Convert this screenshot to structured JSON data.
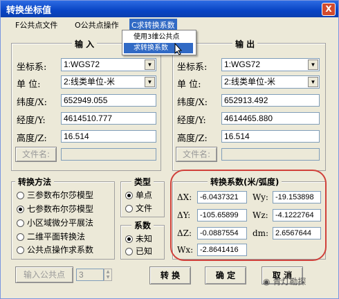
{
  "window": {
    "title": "转换坐标值",
    "close": "X"
  },
  "menu": [
    {
      "label": "F公共点文件"
    },
    {
      "label": "O公共点操作"
    },
    {
      "label": "C求转换系数"
    }
  ],
  "dropdown": [
    "使用3维公共点",
    "求转换系数"
  ],
  "input_panel": {
    "heading": "输 入",
    "coord_sys_label": "坐标系:",
    "coord_sys_value": "1:WGS72",
    "unit_label": "单 位:",
    "unit_value": "2:线类单位-米",
    "lat_label": "纬度/X:",
    "lat_value": "652949.055",
    "lon_label": "经度/Y:",
    "lon_value": "4614510.777",
    "height_label": "高度/Z:",
    "height_value": "16.514",
    "filename_button": "文件名:"
  },
  "output_panel": {
    "heading": "输 出",
    "coord_sys_label": "坐标系:",
    "coord_sys_value": "1:WGS72",
    "unit_label": "单 位:",
    "unit_value": "2:线类单位-米",
    "lat_label": "纬度/X:",
    "lat_value": "652913.492",
    "lon_label": "经度/Y:",
    "lon_value": "4614465.880",
    "height_label": "高度/Z:",
    "height_value": "16.514",
    "filename_button": "文件名:"
  },
  "method": {
    "heading": "转换方法",
    "options": [
      "三参数布尔莎模型",
      "七参数布尔莎模型",
      "小区域微分平展法",
      "二维平面转换法",
      "公共点操作求系数"
    ],
    "selected_index": 1
  },
  "type": {
    "heading": "类型",
    "options": [
      "单点",
      "文件"
    ],
    "selected_index": 0
  },
  "coef": {
    "heading": "系数",
    "options": [
      "未知",
      "已知"
    ],
    "selected_index": 0
  },
  "params": {
    "heading": "转换系数(米/弧度)",
    "dx_label": "ΔX:",
    "dx_value": "-6.0437321",
    "dy_label": "ΔY:",
    "dy_value": "-105.65899",
    "dz_label": "ΔZ:",
    "dz_value": "-0.0887554",
    "wx_label": "Wx:",
    "wx_value": "-2.8641416",
    "wy_label": "Wy:",
    "wy_value": "-19.153898",
    "wz_label": "Wz:",
    "wz_value": "-4.1222764",
    "dm_label": "dm:",
    "dm_value": "2.6567644"
  },
  "bottom": {
    "input_common_button": "输入公共点",
    "spin_value": "3",
    "convert_button": "转 换",
    "ok_button": "确 定",
    "cancel_button": "取 消"
  },
  "watermark": "青灯勘探"
}
